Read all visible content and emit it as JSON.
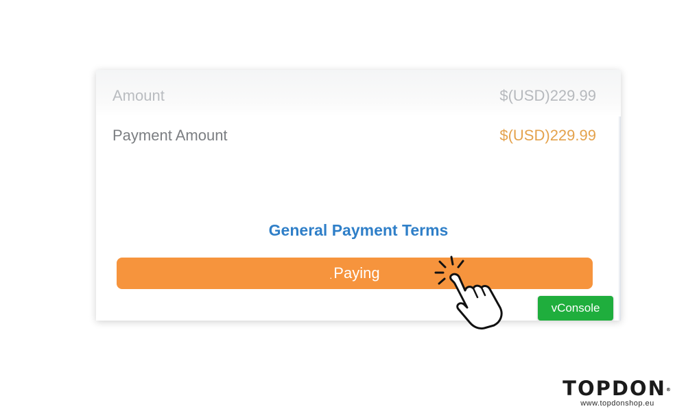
{
  "order": {
    "amount_label": "Amount",
    "amount_value": "$(USD)229.99",
    "payment_amount_label": "Payment Amount",
    "payment_amount_value": "$(USD)229.99"
  },
  "terms_link": "General Payment Terms",
  "pay_button": {
    "dot": ".",
    "label": "Paying"
  },
  "vconsole_button": "vConsole",
  "branding": {
    "logo": "TOPDON",
    "url": "www.topdonshop.eu"
  },
  "colors": {
    "payment_value": "#e4a24c",
    "terms_link": "#2f7fc8",
    "pay_button": "#f6943d",
    "vconsole": "#1fae3d"
  },
  "icons": {
    "cursor": "hand-pointer-click-icon"
  }
}
